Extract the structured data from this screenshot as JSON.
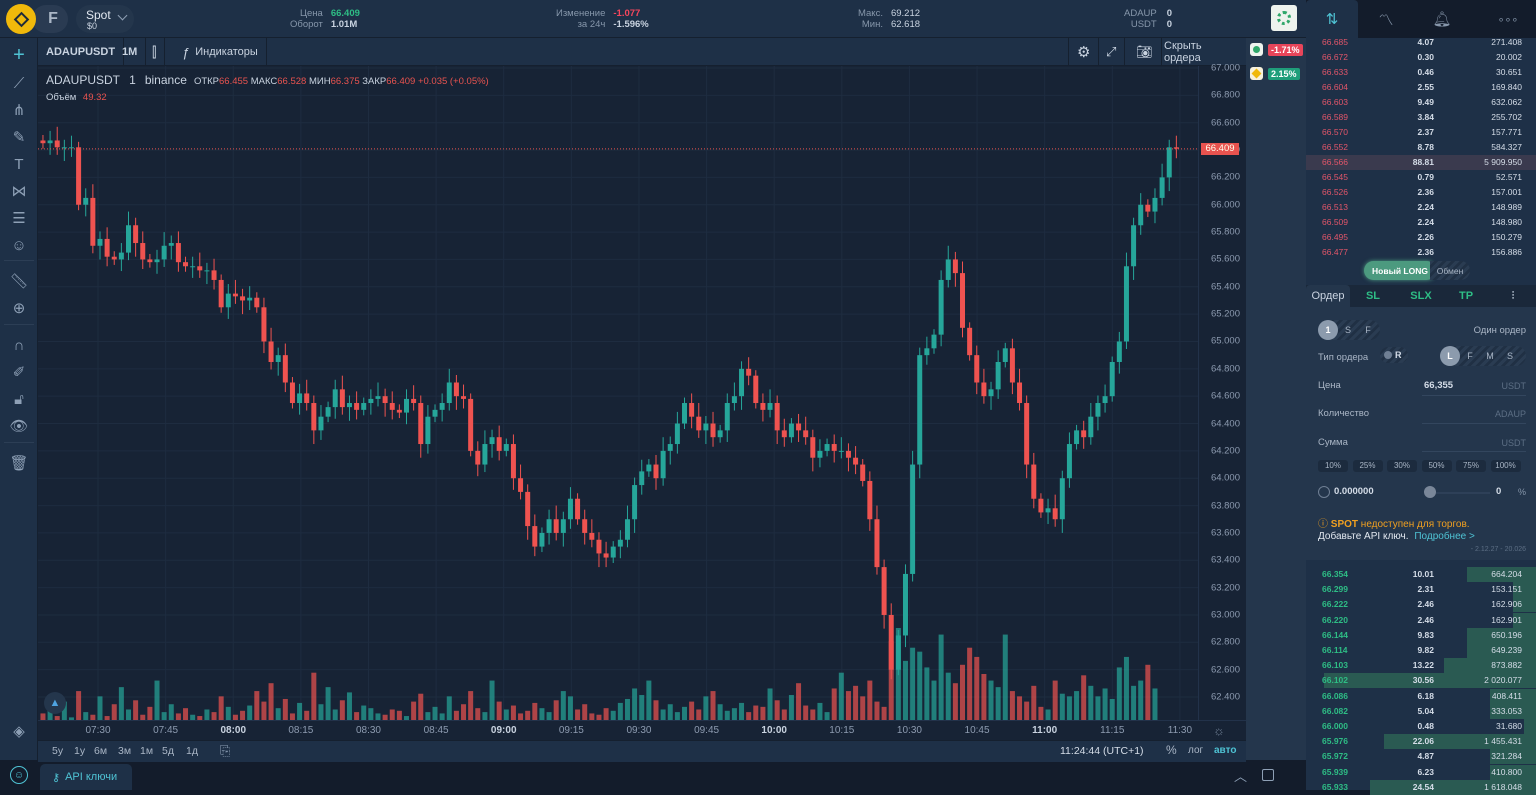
{
  "topbar": {
    "logo": "binance-logo-icon",
    "futures_label": "F",
    "account": {
      "title": "Spot",
      "balance": "$0"
    },
    "stats": [
      {
        "label1": "Цена",
        "label2": "Оборот",
        "value1": "66.409",
        "value2": "1.01M",
        "color1": "#2ebd85"
      },
      {
        "label1": "Изменение",
        "label2": "за 24ч",
        "value1": "-1.077",
        "value2": "-1.596%",
        "color1": "#f6465d"
      },
      {
        "label1": "Макс.",
        "label2": "Мин.",
        "value1": "69.212",
        "value2": "62.618",
        "color1": "#c9d3e0"
      },
      {
        "label1": "ADAUP",
        "label2": "USDT",
        "value1": "0",
        "value2": "0",
        "color1": "#c9d3e0"
      }
    ]
  },
  "right_tabs": [
    "order-tab",
    "chart-analysis-tab",
    "alerts-tab",
    "more-tab"
  ],
  "chart_toolbar": {
    "symbol": "ADAUPUSDT",
    "interval": "1M",
    "indicators": "Индикаторы",
    "hide_orders": "Скрыть ордера"
  },
  "legend": {
    "symbol": "ADAUPUSDT",
    "interval": "1",
    "exchange": "binance",
    "open_label": "ОТКР",
    "open": "66.455",
    "high_label": "МАКС",
    "high": "66.528",
    "low_label": "МИН",
    "low": "66.375",
    "close_label": "ЗАКР",
    "close": "66.409",
    "change": "+0.035 (+0.05%)",
    "volume_label": "Объём",
    "volume": "49.32"
  },
  "pct_panel": [
    {
      "value": "-1.71%",
      "color": "#e8455a"
    },
    {
      "value": "2.15%",
      "color": "#1f9e7a"
    }
  ],
  "range_buttons": [
    "5у",
    "1у",
    "6м",
    "3м",
    "1м",
    "5д",
    "1д"
  ],
  "clock": "11:24:44 (UTC+1)",
  "scale_options": {
    "percent": "%",
    "log": "лог",
    "auto": "авто"
  },
  "bottom": {
    "api_tab": "API ключи"
  },
  "chart_data": {
    "type": "candlestick",
    "title": "ADAUPUSDT 1 binance",
    "ylim": [
      62.3,
      67.05
    ],
    "y_ticks": [
      "67.000",
      "66.800",
      "66.600",
      "66.400",
      "66.200",
      "66.000",
      "65.800",
      "65.600",
      "65.400",
      "65.200",
      "65.000",
      "64.800",
      "64.600",
      "64.400",
      "64.200",
      "64.000",
      "63.800",
      "63.600",
      "63.400",
      "63.200",
      "63.000",
      "62.800",
      "62.600",
      "62.400"
    ],
    "current_price": "66.409",
    "x_ticks": [
      {
        "label": "07:30",
        "bold": false
      },
      {
        "label": "07:45",
        "bold": false
      },
      {
        "label": "08:00",
        "bold": true
      },
      {
        "label": "08:15",
        "bold": false
      },
      {
        "label": "08:30",
        "bold": false
      },
      {
        "label": "08:45",
        "bold": false
      },
      {
        "label": "09:00",
        "bold": true
      },
      {
        "label": "09:15",
        "bold": false
      },
      {
        "label": "09:30",
        "bold": false
      },
      {
        "label": "09:45",
        "bold": false
      },
      {
        "label": "10:00",
        "bold": true
      },
      {
        "label": "10:15",
        "bold": false
      },
      {
        "label": "10:30",
        "bold": false
      },
      {
        "label": "10:45",
        "bold": false
      },
      {
        "label": "11:00",
        "bold": true
      },
      {
        "label": "11:15",
        "bold": false
      },
      {
        "label": "11:30",
        "bold": false
      }
    ],
    "start_time": "07:17",
    "close_path": [
      66.45,
      66.47,
      66.42,
      66.42,
      66.42,
      66.0,
      66.05,
      65.7,
      65.75,
      65.62,
      65.6,
      65.65,
      65.85,
      65.72,
      65.6,
      65.58,
      65.6,
      65.7,
      65.72,
      65.58,
      65.55,
      65.55,
      65.52,
      65.52,
      65.45,
      65.25,
      65.35,
      65.33,
      65.3,
      65.32,
      65.25,
      65.0,
      64.85,
      64.9,
      64.7,
      64.55,
      64.62,
      64.55,
      64.35,
      64.45,
      64.52,
      64.65,
      64.52,
      64.55,
      64.5,
      64.55,
      64.58,
      64.6,
      64.55,
      64.5,
      64.48,
      64.58,
      64.55,
      64.25,
      64.45,
      64.5,
      64.55,
      64.7,
      64.6,
      64.58,
      64.2,
      64.1,
      64.25,
      64.3,
      64.2,
      64.25,
      64.0,
      63.9,
      63.65,
      63.5,
      63.6,
      63.7,
      63.6,
      63.7,
      63.85,
      63.7,
      63.6,
      63.55,
      63.45,
      63.42,
      63.5,
      63.55,
      63.7,
      63.95,
      64.05,
      64.1,
      64.0,
      64.2,
      64.25,
      64.4,
      64.55,
      64.45,
      64.35,
      64.4,
      64.3,
      64.35,
      64.55,
      64.6,
      64.8,
      64.75,
      64.55,
      64.5,
      64.55,
      64.35,
      64.3,
      64.4,
      64.35,
      64.3,
      64.15,
      64.2,
      64.25,
      64.2,
      64.2,
      64.15,
      64.1,
      63.98,
      63.7,
      63.35,
      63.0,
      62.6,
      62.85,
      63.3,
      64.1,
      64.9,
      64.95,
      65.05,
      65.45,
      65.6,
      65.5,
      65.1,
      64.9,
      64.7,
      64.6,
      64.65,
      64.85,
      64.95,
      64.7,
      64.55,
      64.1,
      63.85,
      63.75,
      63.78,
      63.7,
      64.0,
      64.25,
      64.35,
      64.3,
      64.45,
      64.55,
      64.6,
      64.85,
      65.0,
      65.55,
      65.85,
      66.0,
      65.95,
      66.05,
      66.2,
      66.42,
      66.41
    ],
    "volumes": [
      5,
      9,
      3,
      14,
      2,
      22,
      6,
      4,
      18,
      3,
      12,
      25,
      8,
      15,
      4,
      10,
      30,
      6,
      12,
      5,
      9,
      4,
      3,
      8,
      6,
      18,
      10,
      4,
      7,
      11,
      22,
      14,
      28,
      9,
      16,
      5,
      13,
      7,
      36,
      12,
      25,
      8,
      15,
      21,
      6,
      11,
      9,
      5,
      4,
      8,
      7,
      3,
      14,
      20,
      6,
      10,
      5,
      18,
      7,
      12,
      22,
      9,
      6,
      30,
      14,
      8,
      11,
      5,
      7,
      13,
      9,
      6,
      15,
      22,
      18,
      8,
      12,
      5,
      4,
      9,
      7,
      13,
      16,
      24,
      19,
      30,
      15,
      8,
      12,
      6,
      10,
      14,
      8,
      18,
      22,
      12,
      7,
      9,
      13,
      6,
      11,
      10,
      24,
      15,
      8,
      19,
      28,
      11,
      8,
      13,
      6,
      24,
      36,
      22,
      26,
      18,
      30,
      14,
      10,
      60,
      70,
      45,
      55,
      52,
      40,
      30,
      65,
      36,
      28,
      42,
      55,
      48,
      35,
      30,
      25,
      65,
      22,
      18,
      14,
      26,
      10,
      8,
      30,
      20,
      18,
      22,
      34,
      26,
      18,
      24,
      16,
      40,
      48,
      26,
      30,
      42,
      24
    ],
    "colors": {
      "up": "#26a69a",
      "down": "#ef5350"
    }
  },
  "orderbook": {
    "asks": [
      {
        "price": "66.685",
        "qty": "4.07",
        "total": "271.408"
      },
      {
        "price": "66.672",
        "qty": "0.30",
        "total": "20.002"
      },
      {
        "price": "66.633",
        "qty": "0.46",
        "total": "30.651"
      },
      {
        "price": "66.604",
        "qty": "2.55",
        "total": "169.840"
      },
      {
        "price": "66.603",
        "qty": "9.49",
        "total": "632.062"
      },
      {
        "price": "66.589",
        "qty": "3.84",
        "total": "255.702"
      },
      {
        "price": "66.570",
        "qty": "2.37",
        "total": "157.771"
      },
      {
        "price": "66.552",
        "qty": "8.78",
        "total": "584.327"
      },
      {
        "price": "66.566",
        "qty": "88.81",
        "total": "5 909.950"
      },
      {
        "price": "66.545",
        "qty": "0.79",
        "total": "52.571"
      },
      {
        "price": "66.526",
        "qty": "2.36",
        "total": "157.001"
      },
      {
        "price": "66.513",
        "qty": "2.24",
        "total": "148.989"
      },
      {
        "price": "66.509",
        "qty": "2.24",
        "total": "148.980"
      },
      {
        "price": "66.495",
        "qty": "2.26",
        "total": "150.279"
      },
      {
        "price": "66.477",
        "qty": "2.36",
        "total": "156.886"
      }
    ],
    "bids": [
      {
        "price": "66.354",
        "qty": "10.01",
        "total": "664.204",
        "depth": 0.3
      },
      {
        "price": "66.299",
        "qty": "2.31",
        "total": "153.151",
        "depth": 0.1
      },
      {
        "price": "66.222",
        "qty": "2.46",
        "total": "162.906",
        "depth": 0.1
      },
      {
        "price": "66.220",
        "qty": "2.46",
        "total": "162.901",
        "depth": 0.1
      },
      {
        "price": "66.144",
        "qty": "9.83",
        "total": "650.196",
        "depth": 0.3
      },
      {
        "price": "66.114",
        "qty": "9.82",
        "total": "649.239",
        "depth": 0.3
      },
      {
        "price": "66.103",
        "qty": "13.22",
        "total": "873.882",
        "depth": 0.4
      },
      {
        "price": "66.102",
        "qty": "30.56",
        "total": "2 020.077",
        "depth": 0.92
      },
      {
        "price": "66.086",
        "qty": "6.18",
        "total": "408.411",
        "depth": 0.2
      },
      {
        "price": "66.082",
        "qty": "5.04",
        "total": "333.053",
        "depth": 0.2
      },
      {
        "price": "66.000",
        "qty": "0.48",
        "total": "31.680",
        "depth": 0.05
      },
      {
        "price": "65.976",
        "qty": "22.06",
        "total": "1 455.431",
        "depth": 0.66
      },
      {
        "price": "65.972",
        "qty": "4.87",
        "total": "321.284",
        "depth": 0.2
      },
      {
        "price": "65.939",
        "qty": "6.23",
        "total": "410.800",
        "depth": 0.2
      },
      {
        "price": "65.933",
        "qty": "24.54",
        "total": "1 618.048",
        "depth": 0.72
      }
    ]
  },
  "trade_mode": {
    "new_long": "Новый LONG",
    "swap": "Обмен"
  },
  "order_form": {
    "tabs": [
      "Ордер",
      "SL",
      "SLX",
      "TP"
    ],
    "mode_toggle": [
      "1",
      "S",
      "F"
    ],
    "single_order": "Один ордер",
    "order_type_label": "Тип ордера",
    "order_type_toggle": "R",
    "type_toggle": [
      "L",
      "F",
      "M",
      "S"
    ],
    "price_label": "Цена",
    "price_value": "66,355",
    "price_unit": "USDT",
    "qty_label": "Количество",
    "qty_unit": "ADAUP",
    "sum_label": "Сумма",
    "sum_unit": "USDT",
    "percent_buttons": [
      "10%",
      "25%",
      "30%",
      "50%",
      "75%",
      "100%"
    ],
    "balance": "0.000000",
    "slider_value": "0",
    "slider_unit": "%",
    "warning_spot": "SPOT",
    "warning_text": " недоступен для торгов.",
    "add_api": "Добавьте API ключ.",
    "more_link": "Подробнее >",
    "version": "- 2.12.27 - 20.026"
  }
}
